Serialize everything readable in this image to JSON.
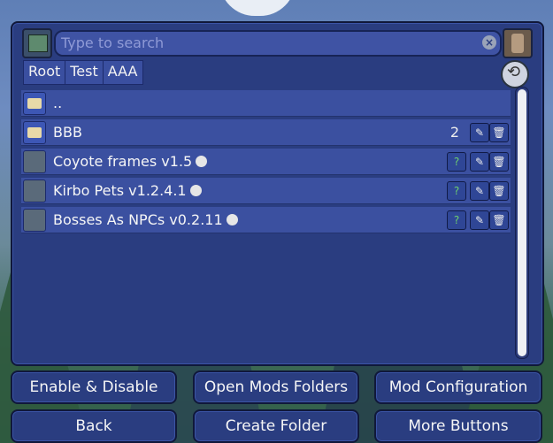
{
  "search": {
    "placeholder": "Type to search",
    "clear_icon": "close-icon"
  },
  "breadcrumb": [
    "Root",
    "Test",
    "AAA"
  ],
  "rows": [
    {
      "name": "..",
      "type": "parent-folder"
    },
    {
      "name": "BBB",
      "type": "folder",
      "count": "2"
    },
    {
      "name": "Coyote frames v1.5",
      "type": "mod"
    },
    {
      "name": "Kirbo Pets v1.2.4.1",
      "type": "mod"
    },
    {
      "name": "Bosses As NPCs v0.2.11",
      "type": "mod"
    }
  ],
  "buttons": {
    "enable_disable": "Enable & Disable",
    "open_mods_folders": "Open Mods Folders",
    "mod_configuration": "Mod Configuration",
    "back": "Back",
    "create_folder": "Create Folder",
    "more_buttons": "More Buttons"
  },
  "colors": {
    "panel": "#2a3d80",
    "row": "#3b50a0",
    "border": "#10183a"
  }
}
